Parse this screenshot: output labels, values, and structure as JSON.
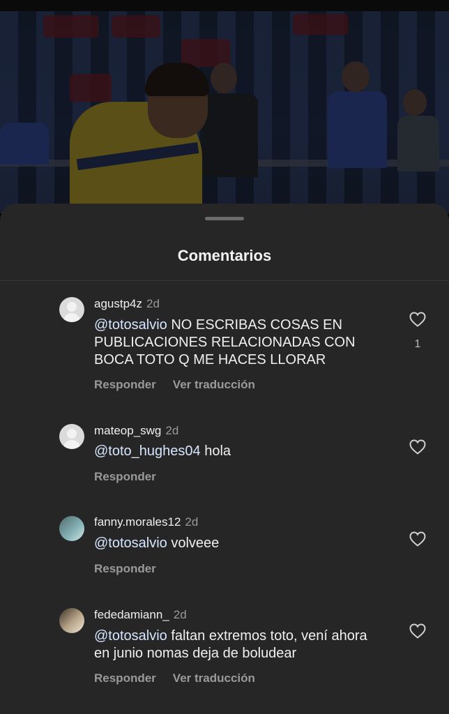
{
  "sheet": {
    "title": "Comentarios"
  },
  "comments": [
    {
      "username": "agustp4z",
      "time": "2d",
      "mention": "@totosalvio",
      "text": " NO ESCRIBAS COSAS EN PUBLICACIONES RELACIONADAS CON BOCA TOTO Q ME HACES LLORAR",
      "likes": "1",
      "reply_label": "Responder",
      "translate_label": "Ver traducción",
      "avatar": "default-avatar"
    },
    {
      "username": "mateop_swg",
      "time": "2d",
      "mention": "@toto_hughes04",
      "text": " hola",
      "likes": "",
      "reply_label": "Responder",
      "translate_label": "",
      "avatar": "default-avatar"
    },
    {
      "username": "fanny.morales12",
      "time": "2d",
      "mention": "@totosalvio",
      "text": " volveee",
      "likes": "",
      "reply_label": "Responder",
      "translate_label": "",
      "avatar": "photo-avatar"
    },
    {
      "username": "fededamiann_",
      "time": "2d",
      "mention": "@totosalvio",
      "text": " faltan extremos toto, vení ahora en junio nomas deja de boludear",
      "likes": "",
      "reply_label": "Responder",
      "translate_label": "Ver traducción",
      "avatar": "photo-avatar"
    }
  ],
  "icons": {
    "like": "heart-icon",
    "drag": "drag-handle"
  }
}
